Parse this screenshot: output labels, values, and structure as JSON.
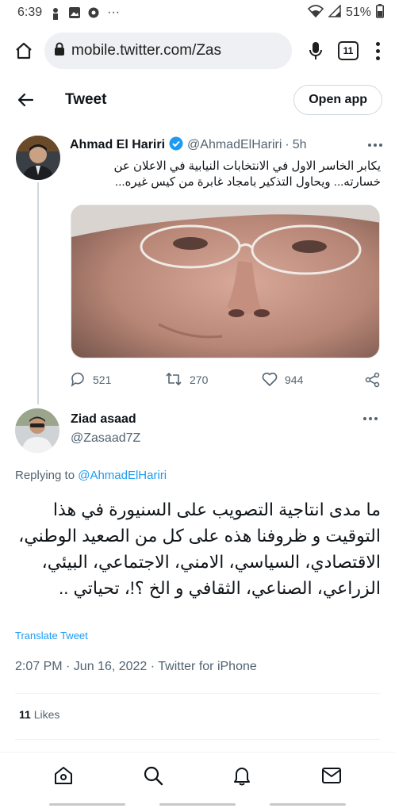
{
  "status_bar": {
    "time": "6:39",
    "battery": "51%",
    "more": "···",
    "icons": [
      "notification-person-icon",
      "image-icon",
      "chrome-icon",
      "wifi-icon",
      "signal-icon",
      "battery-icon"
    ]
  },
  "browser": {
    "url": "mobile.twitter.com/Zas",
    "tab_count": "11",
    "icons": [
      "home-icon",
      "lock-icon",
      "mic-icon",
      "tabs-icon",
      "menu-icon"
    ]
  },
  "header": {
    "title": "Tweet",
    "open_app": "Open app"
  },
  "parent_tweet": {
    "name": "Ahmad El Hariri",
    "handle": "@AhmadElHariri",
    "separator": "·",
    "time": "5h",
    "text": "يكابر الخاسر الاول في الانتخابات النيابية في الاعلان عن خسارته... ويحاول التذكير بامجاد غابرة من كيس غيره...",
    "replies": "521",
    "retweets": "270",
    "likes": "944"
  },
  "reply": {
    "name": "Ziad asaad",
    "handle": "@Zasaad7Z",
    "replying_prefix": "Replying to",
    "replying_to": "@AhmadElHariri",
    "text": "ما مدى انتاجية التصويب على السنيورة في هذا التوقيت و ظروفنا هذه على كل من الصعيد الوطني، الاقتصادي، السياسي، الامني، الاجتماعي، البيئي، الزراعي، الصناعي، الثقافي و الخ ؟!، تحياتي ..",
    "translate": "Translate Tweet",
    "meta": "2:07 PM · Jun 16, 2022 · Twitter for iPhone",
    "like_count": "11",
    "like_label": "Likes"
  },
  "colors": {
    "accent": "#1d9bf0",
    "text": "#0f1419",
    "secondary": "#536471"
  },
  "bottom_nav": [
    "home-icon",
    "search-icon",
    "notifications-icon",
    "messages-icon"
  ]
}
